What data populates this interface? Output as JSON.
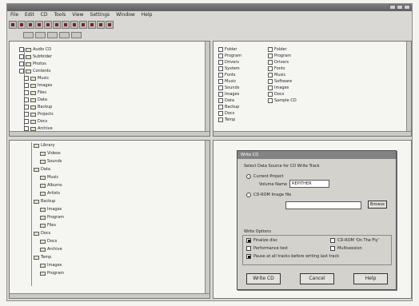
{
  "window": {
    "title": "",
    "controls": [
      "minimize-icon",
      "maximize-icon",
      "close-icon"
    ]
  },
  "menus": [
    "File",
    "Edit",
    "CD",
    "Tools",
    "View",
    "Settings",
    "Window",
    "Help"
  ],
  "toolbar": {
    "buttons": [
      "new-icon",
      "open-icon",
      "save-icon",
      "cut-icon",
      "copy-icon",
      "paste-icon",
      "undo-icon",
      "redo-icon",
      "cd-icon",
      "record-icon",
      "settings-icon",
      "help-icon"
    ]
  },
  "left_top_tree": [
    "Audio CD",
    "Subfolder",
    "Photos",
    "Contents",
    "Music",
    "Images",
    "Files",
    "Data",
    "Backup",
    "Projects",
    "Docs",
    "Archive"
  ],
  "right_top_columns": {
    "col1": [
      "Folder",
      "Program",
      "Drivers",
      "System",
      "Fonts",
      "Music",
      "Sounds",
      "Images",
      "Data",
      "Backup",
      "Docs",
      "Temp"
    ],
    "col2": [
      "Folder",
      "Program",
      "Drivers",
      "Fonts",
      "Music",
      "Software",
      "Images",
      "Docs",
      "Sample CD"
    ]
  },
  "left_bottom_tree": [
    "Library",
    "Videos",
    "Sounds",
    "Data",
    "Music",
    "Albums",
    "Artists",
    "Backup",
    "Images",
    "Program",
    "Files",
    "Docs",
    "Docs",
    "Archive",
    "Temp",
    "Images",
    "Program"
  ],
  "dialog": {
    "title": "Write CD",
    "heading": "Select Data Source for CD Write Track",
    "option_current": "Current Project",
    "volume_label": "Volume Name",
    "volume_value": "REPITHER",
    "option_iso": "CD-ROM Image file",
    "iso_placeholder": "",
    "browse_label": "Browse",
    "write_options_label": "Write Options",
    "opt_finalize": "Finalize disc",
    "opt_test": "Performance test",
    "opt_pause": "Pause at all tracks before writing last track",
    "opt_cdrom": "CD-ROM 'On The Fly'",
    "opt_multisession": "Multisession",
    "btn_write": "Write CD",
    "btn_cancel": "Cancel",
    "btn_help": "Help"
  }
}
